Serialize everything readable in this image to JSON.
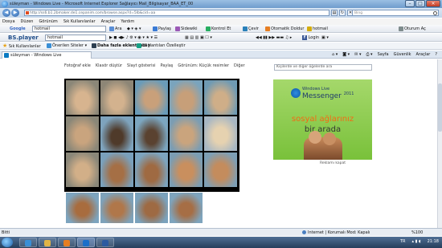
{
  "window": {
    "title": "süleyman - Windows Live - Microsoft Internet Explorer Sağlayıcı Mail_Bilgisayar_BAA_ET_00"
  },
  "address": {
    "url": "http://ss6.b1.2bmaker.de1.cepanim.com/browse.aspx?d=5lb&cid=aa"
  },
  "bing": {
    "placeholder": "Bing"
  },
  "menu": [
    "Dosya",
    "Düzen",
    "Görünüm",
    "Sık Kullanılanlar",
    "Araçlar",
    "Yardım"
  ],
  "toolbar1": {
    "google_label": "Google",
    "google_query": "hotmail",
    "ara": "Ara",
    "paylas": "Paylaş",
    "sidewiki": "Sidewiki",
    "kontrol": "Kontrol Et",
    "cevir": "Çevir",
    "otomatik": "Otomatik Doldur",
    "hotmail": "hotmail",
    "oturum": "Oturum Aç"
  },
  "toolbar2": {
    "bsplayer": "BS.player",
    "query": "hotmail",
    "login": "Login"
  },
  "favbar": {
    "favorites": "Sık Kullanılanlar",
    "suggested": "Önerilen Siteler",
    "get_more": "Daha fazla eklenti bul",
    "custom": "Bağlantıları Özelleştir"
  },
  "tab": {
    "label": "süleyman - Windows Live"
  },
  "commands": [
    "Sayfa",
    "Güvenlik",
    "Araçlar"
  ],
  "photo_links": [
    "Fotoğraf ekle",
    "Klasör düştür",
    "Slayt gösterisi",
    "Paylaş",
    "Görünüm: Küçük resimler",
    "Diğer"
  ],
  "side": {
    "search": "Kişilerde ve diğer öğelerde ara",
    "ad_brand": "Windows Live",
    "ad_product": "Messenger",
    "ad_year": "2011",
    "ad_line1": "sosyal ağlarınız",
    "ad_line2": "bir arada",
    "ad_close": "Reklamı kapat"
  },
  "status": {
    "left": "Bitti",
    "zone": "Internet | Korumalı Mod: Kapalı",
    "zoom": "%100"
  },
  "taskbar": {
    "lang": "TR",
    "time": "21:18"
  }
}
